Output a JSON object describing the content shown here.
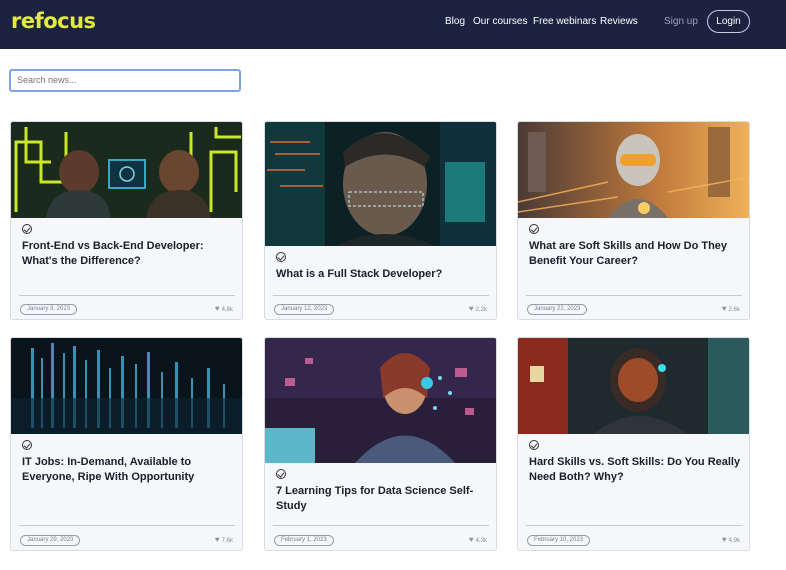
{
  "brand": {
    "logo": "refocus"
  },
  "nav": {
    "links": [
      "Blog",
      "Our courses",
      "Free webinars",
      "Reviews"
    ],
    "signup": "Sign up",
    "login": "Login"
  },
  "search": {
    "placeholder": "Search news..."
  },
  "colors": {
    "header_bg": "#1c2340",
    "logo": "#e3ea3c",
    "card_bg": "#f6f7fa",
    "search_border": "#7ea3e6"
  },
  "articles": [
    {
      "title": "Front-End vs Back-End Developer: What's the Difference?",
      "date": "January 3, 2023",
      "likes": "4,8k",
      "icon": "check-circle-icon"
    },
    {
      "title": "What is a Full Stack Developer?",
      "date": "January 12, 2023",
      "likes": "2,2k",
      "icon": "check-circle-icon"
    },
    {
      "title": "What are Soft Skills and How Do They Benefit Your Career?",
      "date": "January 22, 2023",
      "likes": "2,6k",
      "icon": "check-circle-icon"
    },
    {
      "title": "IT Jobs: In-Demand, Available to Everyone, Ripe With Opportunity",
      "date": "January 29, 2023",
      "likes": "7,6k",
      "icon": "check-circle-icon"
    },
    {
      "title": "7 Learning Tips for Data Science Self-Study",
      "date": "February 1, 2023",
      "likes": "4,3k",
      "icon": "check-circle-icon"
    },
    {
      "title": "Hard Skills vs. Soft Skills: Do You Really Need Both? Why?",
      "date": "February 10, 2023",
      "likes": "4,9k",
      "icon": "check-circle-icon"
    }
  ]
}
